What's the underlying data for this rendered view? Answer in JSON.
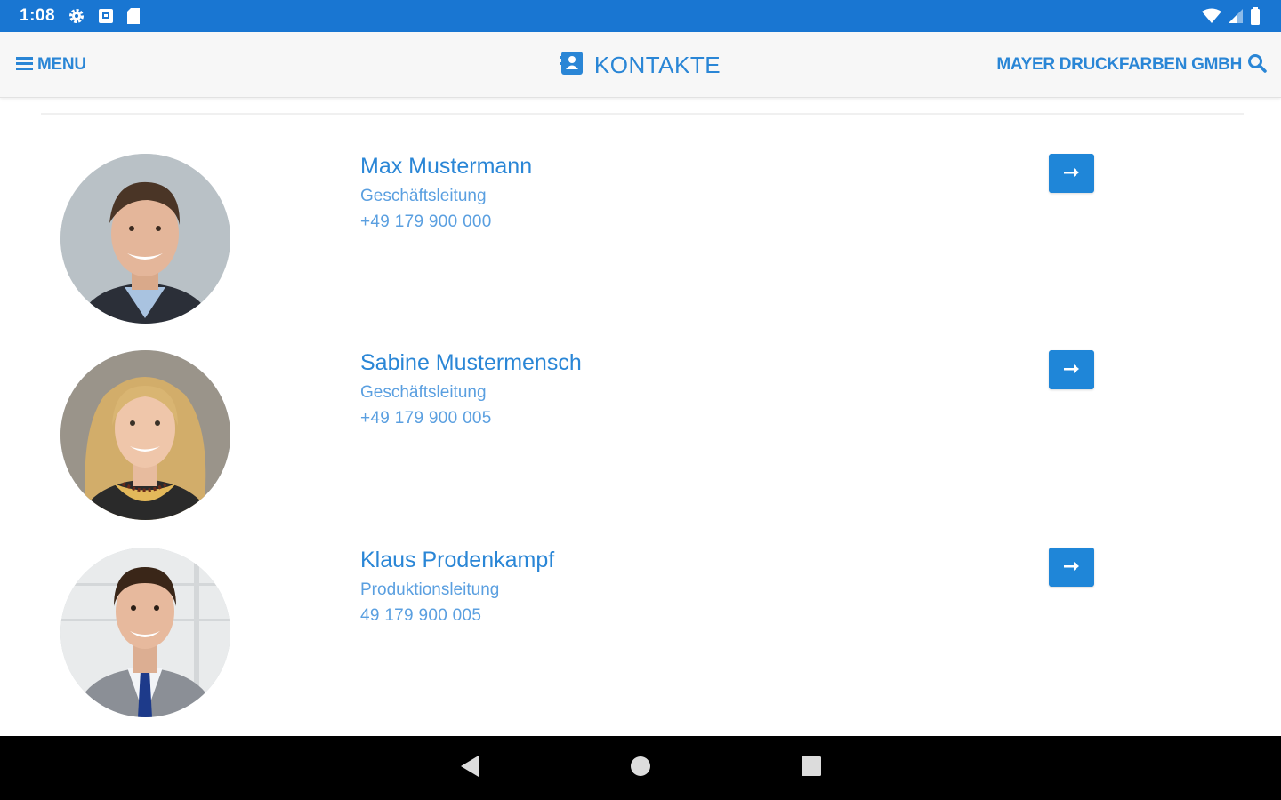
{
  "status_bar": {
    "time": "1:08",
    "left_icons": [
      "settings-icon",
      "notification-box-icon",
      "sd-card-icon"
    ],
    "right_icons": [
      "wifi-icon",
      "cell-signal-icon",
      "battery-icon"
    ]
  },
  "header": {
    "menu_label": "MENU",
    "title": "KONTAKTE",
    "company_label": "MAYER DRUCKFARBEN GMBH",
    "accent_color": "#2a86d6"
  },
  "contacts": [
    {
      "name": "Max Mustermann",
      "role": "Geschäftsleitung",
      "phone": "+49 179 900 000"
    },
    {
      "name": "Sabine Mustermensch",
      "role": "Geschäftsleitung",
      "phone": "+49 179 900 005"
    },
    {
      "name": "Klaus Prodenkampf",
      "role": "Produktionsleitung",
      "phone": "49 179 900 005"
    }
  ],
  "nav_bar": {
    "buttons": [
      "back-icon",
      "home-icon",
      "recents-icon"
    ]
  },
  "colors": {
    "status_bar": "#1976d2",
    "button": "#1f86d8",
    "text_primary": "#2a86d6",
    "text_secondary": "#5a9fe0"
  }
}
